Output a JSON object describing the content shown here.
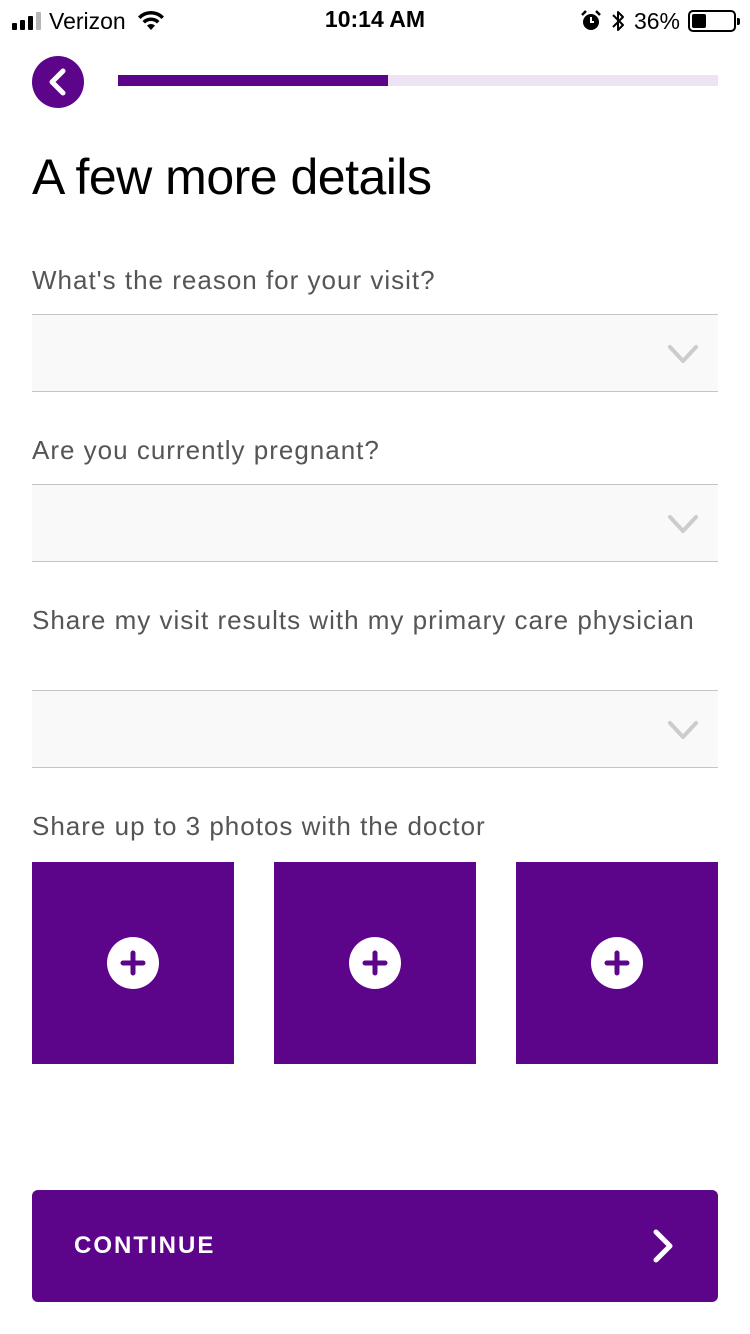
{
  "status_bar": {
    "carrier": "Verizon",
    "time": "10:14 AM",
    "battery": "36%",
    "battery_level": 0.36
  },
  "progress": {
    "fraction": 0.45
  },
  "colors": {
    "brand": "#5c058a",
    "progress_track": "#ede3f2",
    "select_bg": "#f9f9f9",
    "chevron": "#cccccc"
  },
  "page": {
    "title": "A few more details"
  },
  "fields": {
    "reason": {
      "label": "What's the reason for your visit?",
      "value": ""
    },
    "pregnant": {
      "label": "Are you currently pregnant?",
      "value": ""
    },
    "share_results": {
      "label": "Share my visit results with my primary care physician",
      "value": ""
    }
  },
  "photos": {
    "label": "Share up to 3 photos with the doctor",
    "slots": [
      "add-photo",
      "add-photo",
      "add-photo"
    ]
  },
  "footer": {
    "continue_label": "CONTINUE"
  },
  "icons": {
    "back": "chevron-left-icon",
    "select": "chevron-down-icon",
    "add": "plus-icon",
    "continue": "chevron-right-icon"
  }
}
